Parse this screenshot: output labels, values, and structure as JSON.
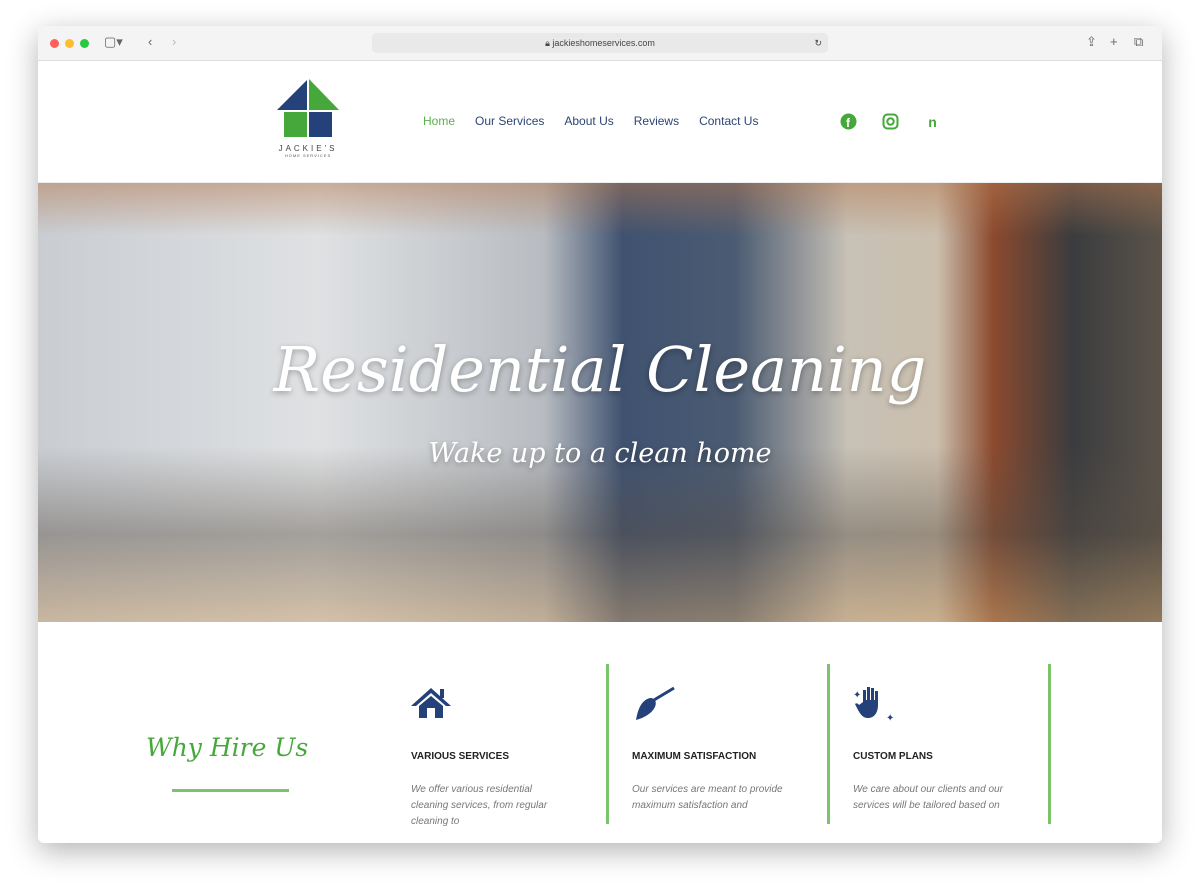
{
  "browser": {
    "url": "jackieshomeservices.com"
  },
  "logo": {
    "name": "JACKIE'S",
    "tagline": "HOME SERVICES"
  },
  "nav": [
    {
      "label": "Home",
      "active": true
    },
    {
      "label": "Our Services"
    },
    {
      "label": "About Us"
    },
    {
      "label": "Reviews"
    },
    {
      "label": "Contact Us"
    }
  ],
  "social": [
    "facebook-icon",
    "instagram-icon",
    "nextdoor-icon"
  ],
  "hero": {
    "title": "Residential Cleaning",
    "subtitle": "Wake up to a clean home"
  },
  "why": {
    "title": "Why Hire Us"
  },
  "cards": [
    {
      "icon": "house-icon",
      "title": "VARIOUS SERVICES",
      "text": "We offer various residential cleaning services, from regular cleaning to"
    },
    {
      "icon": "broom-icon",
      "title": "MAXIMUM SATISFACTION",
      "text": "Our services are meant to provide maximum satisfaction and"
    },
    {
      "icon": "sparkle-hand-icon",
      "title": "CUSTOM PLANS",
      "text": "We care about our clients and our services will be tailored based on"
    }
  ],
  "colors": {
    "green": "#46a83a",
    "navy": "#24417a"
  }
}
